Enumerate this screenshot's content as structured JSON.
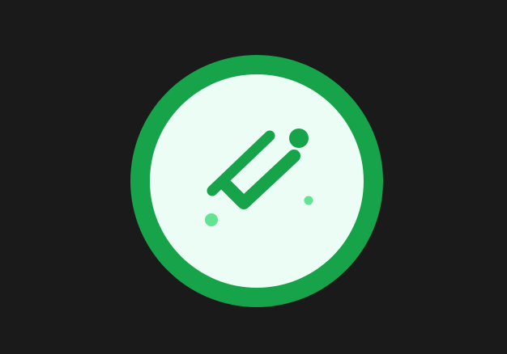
{
  "colors": {
    "background": "#1a1a1a",
    "ring": "#16a34a",
    "inner_fill": "#ecfdf5",
    "accent": "#22c55e"
  },
  "icons": {
    "main": "checkmark-success-icon",
    "sparkles": "sparkle-dot-icon"
  }
}
